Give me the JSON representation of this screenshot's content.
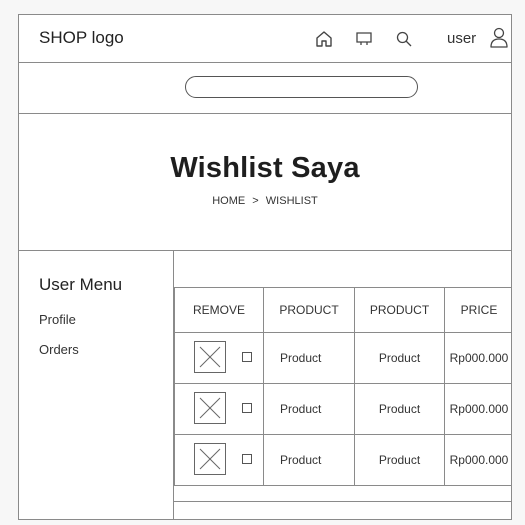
{
  "header": {
    "logo": "SHOP logo",
    "user_label": "user",
    "icons": [
      "home-icon",
      "cart-icon",
      "search-icon",
      "user-icon"
    ]
  },
  "search": {
    "placeholder": ""
  },
  "title_block": {
    "title": "Wishlist Saya",
    "breadcrumb": [
      "HOME",
      ">",
      "WISHLIST"
    ]
  },
  "sidebar": {
    "title": "User Menu",
    "items": [
      {
        "label": "Profile"
      },
      {
        "label": "Orders"
      }
    ]
  },
  "table": {
    "headers": [
      "REMOVE",
      "PRODUCT",
      "PRODUCT",
      "PRICE"
    ],
    "rows": [
      {
        "product1": "Product",
        "product2": "Product",
        "price": "Rp000.000"
      },
      {
        "product1": "Product",
        "product2": "Product",
        "price": "Rp000.000"
      },
      {
        "product1": "Product",
        "product2": "Product",
        "price": "Rp000.000"
      }
    ]
  },
  "colors": {
    "line": "#8a8a8a",
    "text": "#222222",
    "background": "#ffffff"
  }
}
